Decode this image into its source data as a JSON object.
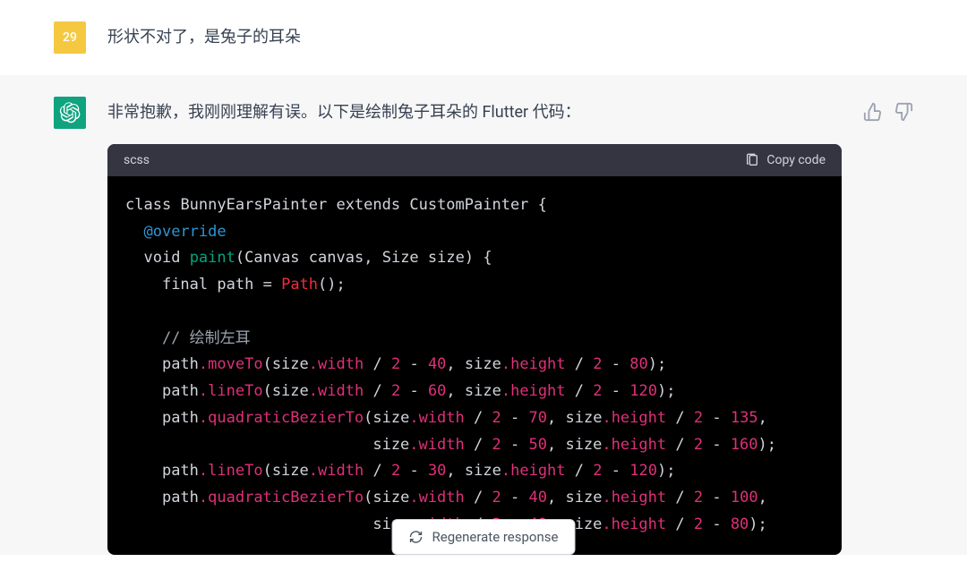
{
  "user": {
    "avatar": "29",
    "message": "形状不对了，是兔子的耳朵"
  },
  "assistant": {
    "message": "非常抱歉，我刚刚理解有误。以下是绘制兔子耳朵的 Flutter 代码：",
    "code": {
      "language": "scss",
      "copy_label": "Copy code",
      "lines": [
        {
          "t": "class BunnyEarsPainter extends CustomPainter {"
        },
        {
          "t": "  @override"
        },
        {
          "t": "  void paint(Canvas canvas, Size size) {"
        },
        {
          "t": "    final path = Path();"
        },
        {
          "t": ""
        },
        {
          "t": "    // 绘制左耳"
        },
        {
          "t": "    path.moveTo(size.width / 2 - 40, size.height / 2 - 80);"
        },
        {
          "t": "    path.lineTo(size.width / 2 - 60, size.height / 2 - 120);"
        },
        {
          "t": "    path.quadraticBezierTo(size.width / 2 - 70, size.height / 2 - 135,"
        },
        {
          "t": "                           size.width / 2 - 50, size.height / 2 - 160);"
        },
        {
          "t": "    path.lineTo(size.width / 2 - 30, size.height / 2 - 120);"
        },
        {
          "t": "    path.quadraticBezierTo(size.width / 2 - 40, size.height / 2 - 100,"
        },
        {
          "t": "                           size.width / 2 - 40, size.height / 2 - 80);"
        }
      ]
    }
  },
  "regenerate_label": "Regenerate response"
}
